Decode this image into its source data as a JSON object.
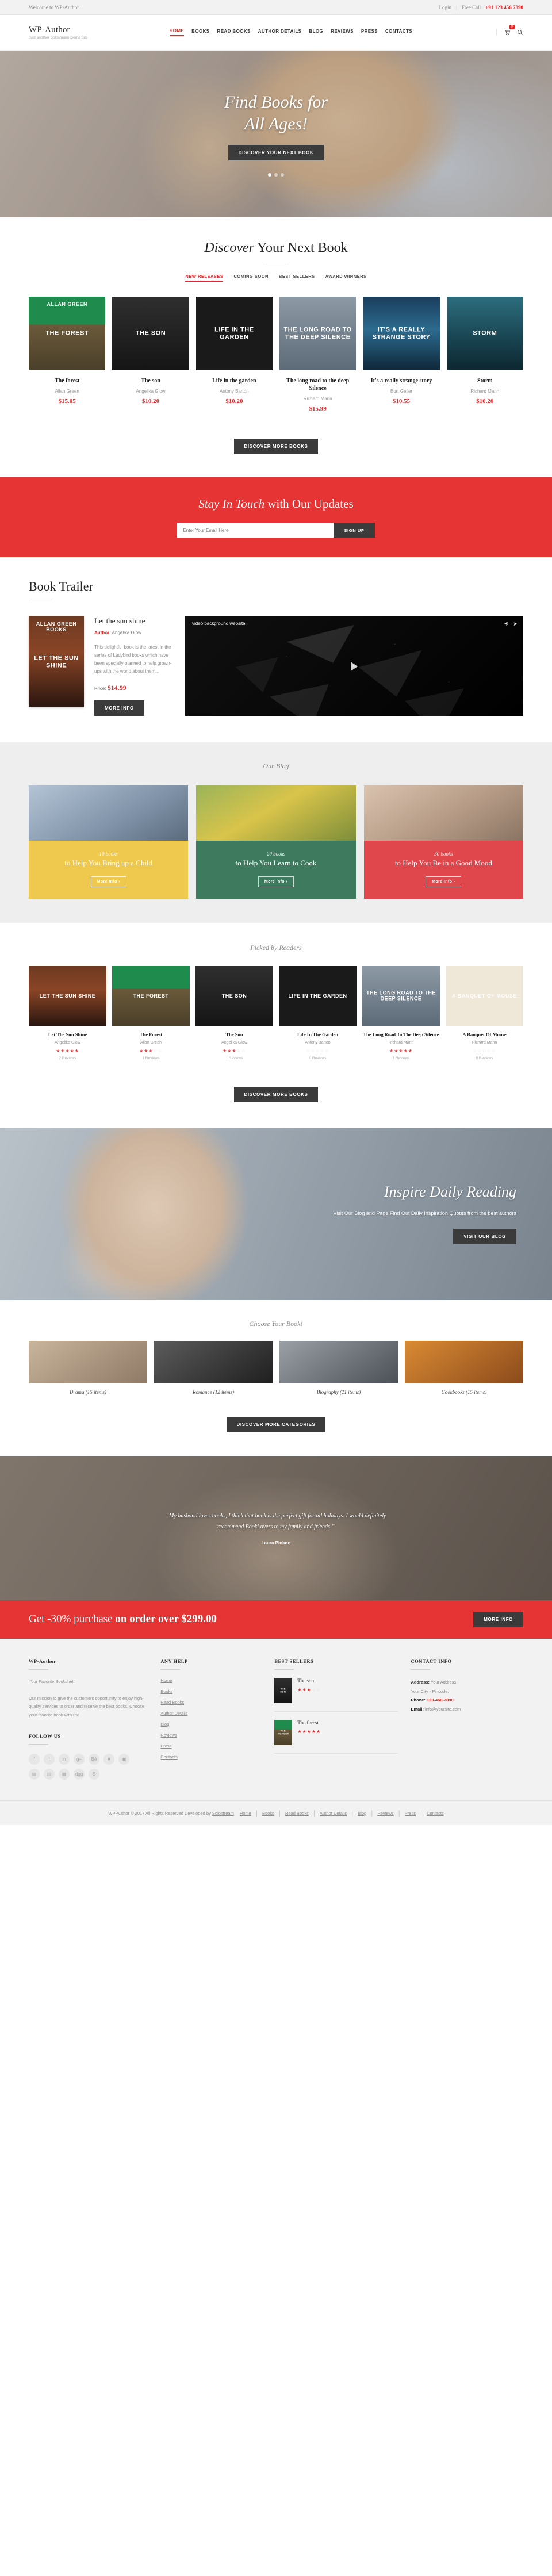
{
  "topbar": {
    "welcome": "Welcome to WP-Author.",
    "login": "Login",
    "free_call_label": "Free Call",
    "phone": "+91 123 456 7890"
  },
  "header": {
    "logo_title": "WP-Author",
    "logo_sub": "Just another Solostream Demo Site",
    "nav": [
      {
        "label": "HOME",
        "active": true
      },
      {
        "label": "BOOKS",
        "active": false
      },
      {
        "label": "READ BOOKS",
        "active": false
      },
      {
        "label": "AUTHOR DETAILS",
        "active": false
      },
      {
        "label": "BLOG",
        "active": false
      },
      {
        "label": "REVIEWS",
        "active": false
      },
      {
        "label": "PRESS",
        "active": false
      },
      {
        "label": "CONTACTS",
        "active": false
      }
    ],
    "cart_count": "0"
  },
  "hero": {
    "line1": "Find Books for",
    "line2": "All Ages!",
    "cta": "DISCOVER YOUR NEXT BOOK"
  },
  "discover": {
    "title_em": "Discover",
    "title_rest": " Your Next Book",
    "tabs": [
      {
        "label": "NEW RELEASES",
        "active": true
      },
      {
        "label": "COMING SOON",
        "active": false
      },
      {
        "label": "BEST SELLERS",
        "active": false
      },
      {
        "label": "AWARD WINNERS",
        "active": false
      }
    ],
    "books": [
      {
        "title": "The forest",
        "author": "Allan Green",
        "price": "$15.05",
        "cover_class": "c-forest",
        "cover_top": "ALLAN GREEN",
        "cover_txt": "THE FOREST"
      },
      {
        "title": "The son",
        "author": "Angelika Glow",
        "price": "$10.20",
        "cover_class": "c-son",
        "cover_top": "",
        "cover_txt": "THE SON"
      },
      {
        "title": "Life in the garden",
        "author": "Antony Barton",
        "price": "$10.20",
        "cover_class": "c-garden",
        "cover_top": "",
        "cover_txt": "LIFE IN THE GARDEN"
      },
      {
        "title": "The long road to the deep Silence",
        "author": "Richard Mann",
        "price": "$15.99",
        "cover_class": "c-long",
        "cover_top": "",
        "cover_txt": "THE LONG ROAD TO THE DEEP SILENCE"
      },
      {
        "title": "It's a really strange story",
        "author": "Burt Geller",
        "price": "$10.55",
        "cover_class": "c-strange",
        "cover_top": "",
        "cover_txt": "IT'S A REALLY STRANGE STORY"
      },
      {
        "title": "Storm",
        "author": "Richard Mann",
        "price": "$10.20",
        "cover_class": "c-storm",
        "cover_top": "",
        "cover_txt": "STORM"
      }
    ],
    "more_button": "DISCOVER MORE BOOKS"
  },
  "newsletter": {
    "title_em": "Stay In Touch",
    "title_rest": " with Our Updates",
    "placeholder": "Enter Your Email Here",
    "button": "SIGN UP"
  },
  "trailer": {
    "heading": "Book Trailer",
    "book_title": "Let the sun shine",
    "author_label": "Author:",
    "author": "Angelika Glow",
    "description": "This delightful book is the latest in the series of Ladybird books which have been specially planned to help grown-ups with the world about them...",
    "price_label": "Price:",
    "price": "$14.99",
    "more_button": "MORE INFO",
    "video_label": "video background website",
    "cover_top": "ALLAN GREEN BOOKS",
    "cover_txt": "LET THE SUN SHINE"
  },
  "blog": {
    "subtitle": "Our Blog",
    "posts": [
      {
        "count": "10 books",
        "title": "to Help You Bring up a Child",
        "more": "More Info ›",
        "img_class": "b1",
        "body_class": "y1"
      },
      {
        "count": "20 books",
        "title": "to Help You Learn to Cook",
        "more": "More Info ›",
        "img_class": "b2",
        "body_class": "y2"
      },
      {
        "count": "30 books",
        "title": "to Help You Be in a Good Mood",
        "more": "More Info ›",
        "img_class": "b3",
        "body_class": "y3"
      }
    ]
  },
  "picked": {
    "subtitle": "Picked by Readers",
    "books": [
      {
        "title": "Let The Sun Shine",
        "author": "Angelika Glow",
        "stars": 5,
        "reviews": "2 Reviews",
        "cover_class": "c-sun",
        "cover_txt": "LET THE SUN SHINE"
      },
      {
        "title": "The Forest",
        "author": "Allan Green",
        "stars": 3,
        "reviews": "1 Reviews",
        "cover_class": "c-forest",
        "cover_txt": "THE FOREST"
      },
      {
        "title": "The Son",
        "author": "Angelika Glow",
        "stars": 3,
        "reviews": "1 Reviews",
        "cover_class": "c-son",
        "cover_txt": "THE SON"
      },
      {
        "title": "Life In The Garden",
        "author": "Antony Barton",
        "stars": 0,
        "reviews": "0 Reviews",
        "cover_class": "c-garden",
        "cover_txt": "LIFE IN THE GARDEN"
      },
      {
        "title": "The Long Road To The Deep Silence",
        "author": "Richard Mann",
        "stars": 5,
        "reviews": "1 Reviews",
        "cover_class": "c-long",
        "cover_txt": "THE LONG ROAD TO THE DEEP SILENCE"
      },
      {
        "title": "A Banquet Of Mouse",
        "author": "Richard Mann",
        "stars": 0,
        "reviews": "0 Reviews",
        "cover_class": "c-banquet",
        "cover_txt": "A BANQUET OF MOUSE"
      }
    ],
    "more_button": "DISCOVER MORE BOOKS"
  },
  "inspire": {
    "title": "Inspire Daily Reading",
    "text": "Visit Our Blog and Page Find Out Daily Inspiration Quotes from the best authors",
    "button": "VISIT OUR BLOG"
  },
  "categories": {
    "subtitle": "Choose Your Book!",
    "items": [
      {
        "name": "Drama (15 items)",
        "img_class": "cat-a"
      },
      {
        "name": "Romance (12 items)",
        "img_class": "cat-b"
      },
      {
        "name": "Biography (21 items)",
        "img_class": "cat-c"
      },
      {
        "name": "Cookbooks (15 items)",
        "img_class": "cat-d"
      }
    ],
    "more_button": "DISCOVER MORE CATEGORIES"
  },
  "testimonial": {
    "quote": "“My husband loves books, I think that book is the perfect gift for all holidays. I would definitely recommend Bookl.overs to my family and friends.”",
    "author": "Laura Pinkon"
  },
  "promo": {
    "text_prefix": "Get -30% purchase ",
    "text_bold": "on order over $299.00",
    "button": "MORE INFO"
  },
  "footer": {
    "col1": {
      "title": "WP-Author",
      "tagline": "Your Favorite Bookshelf!",
      "body": "Our mission to give the customers opportunity to enjoy high-quality services to order and receive the best books. Choose your favorite book with us!",
      "follow_title": "FOLLOW US",
      "social": [
        "f",
        "t",
        "in",
        "g+",
        "Bē",
        "✖",
        "▣",
        "▤",
        "▥",
        "▦",
        "dgg",
        "S"
      ]
    },
    "col2": {
      "title": "ANY HELP",
      "links": [
        "Home",
        "Books",
        "Read Books",
        "Author Details",
        "Blog",
        "Reviews",
        "Press",
        "Contacts"
      ]
    },
    "col3": {
      "title": "BEST SELLERS",
      "items": [
        {
          "name": "The son",
          "stars": 3,
          "cover_class": "c-son",
          "cover_txt": "THE SON"
        },
        {
          "name": "The forest",
          "stars": 5,
          "cover_class": "c-forest",
          "cover_txt": "THE FOREST"
        }
      ]
    },
    "col4": {
      "title": "CONTACT INFO",
      "address_label": "Address:",
      "address": "Your Address",
      "address_line2": "Your City - Pincode.",
      "phone_label": "Phone:",
      "phone": "123-456-7890",
      "email_label": "Email:",
      "email": "info@yoursite.com"
    },
    "bottom": {
      "copy": "WP-Author © 2017 All Rights Reserved Developed by ",
      "developer": "Solostream",
      "links": [
        "Home",
        "Books",
        "Read Books",
        "Author Details",
        "Blog",
        "Reviews",
        "Press",
        "Contacts"
      ]
    }
  }
}
